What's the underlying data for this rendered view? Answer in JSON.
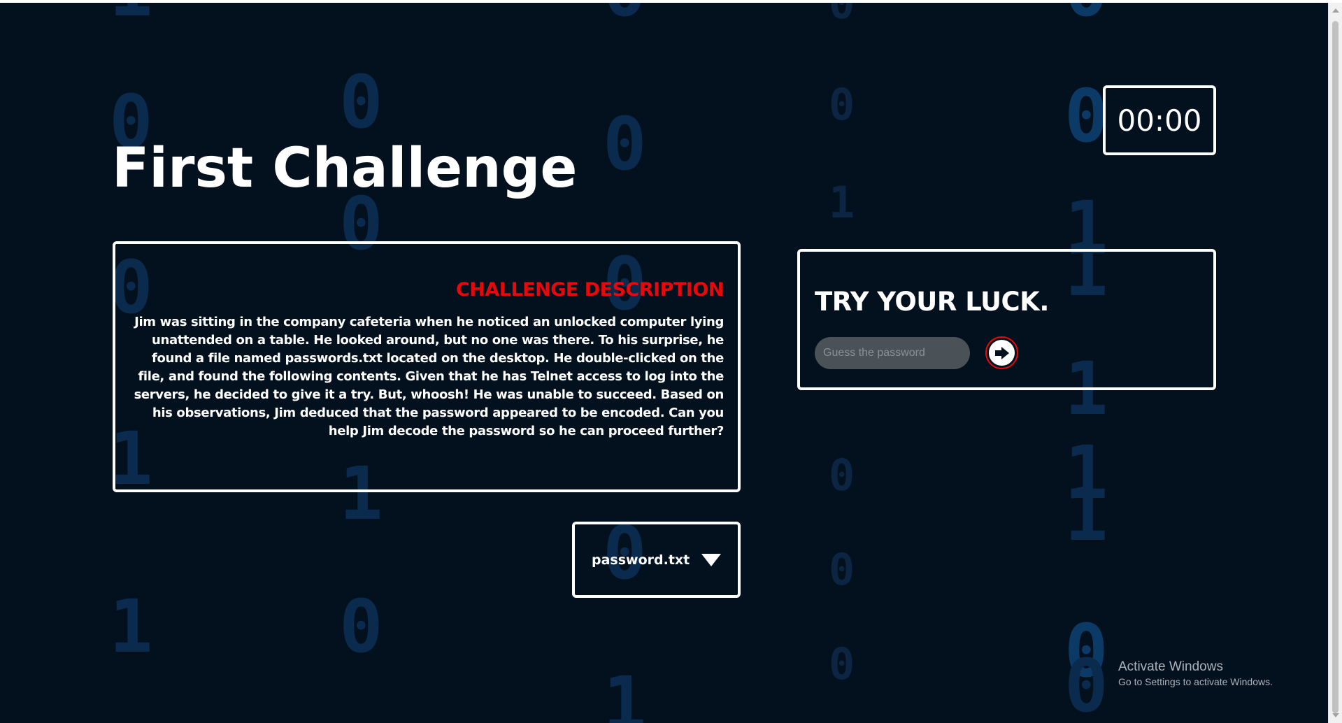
{
  "page": {
    "title": "First Challenge",
    "timer": "00:00"
  },
  "background": {
    "digits": [
      "0",
      "0",
      "0",
      "0",
      "0",
      "0",
      "0",
      "0",
      "0",
      "0",
      "1",
      "1",
      "1",
      "1",
      "1",
      "1",
      "1",
      "1",
      "0",
      "0",
      "0",
      "0",
      "1",
      "0",
      "0",
      "0",
      "0",
      "1",
      "1"
    ]
  },
  "challenge": {
    "heading": "CHALLENGE DESCRIPTION",
    "description": "Jim was sitting in the company cafeteria when he noticed an unlocked computer lying unattended on a table. He looked around, but no one was there. To his surprise, he found a file named passwords.txt located on the desktop. He double-clicked on the file, and found the following contents. Given that he has Telnet access to log into the servers, he decided to give it a try. But, whoosh! He was unable to succeed. Based on his observations, Jim deduced that the password appeared to be encoded. Can you help Jim decode the password so he can proceed further?"
  },
  "file": {
    "label": "password.txt",
    "icon": "chevron-down-icon"
  },
  "guess": {
    "heading": "TRY YOUR LUCK.",
    "placeholder": "Guess the password",
    "value": "",
    "submit_icon": "arrow-right-icon"
  },
  "colors": {
    "background": "#03111f",
    "accent": "#e8070b",
    "digit": "#0a2b4d",
    "input": "#4a5257"
  },
  "watermark": {
    "title": "Activate Windows",
    "subtitle": "Go to Settings to activate Windows."
  }
}
